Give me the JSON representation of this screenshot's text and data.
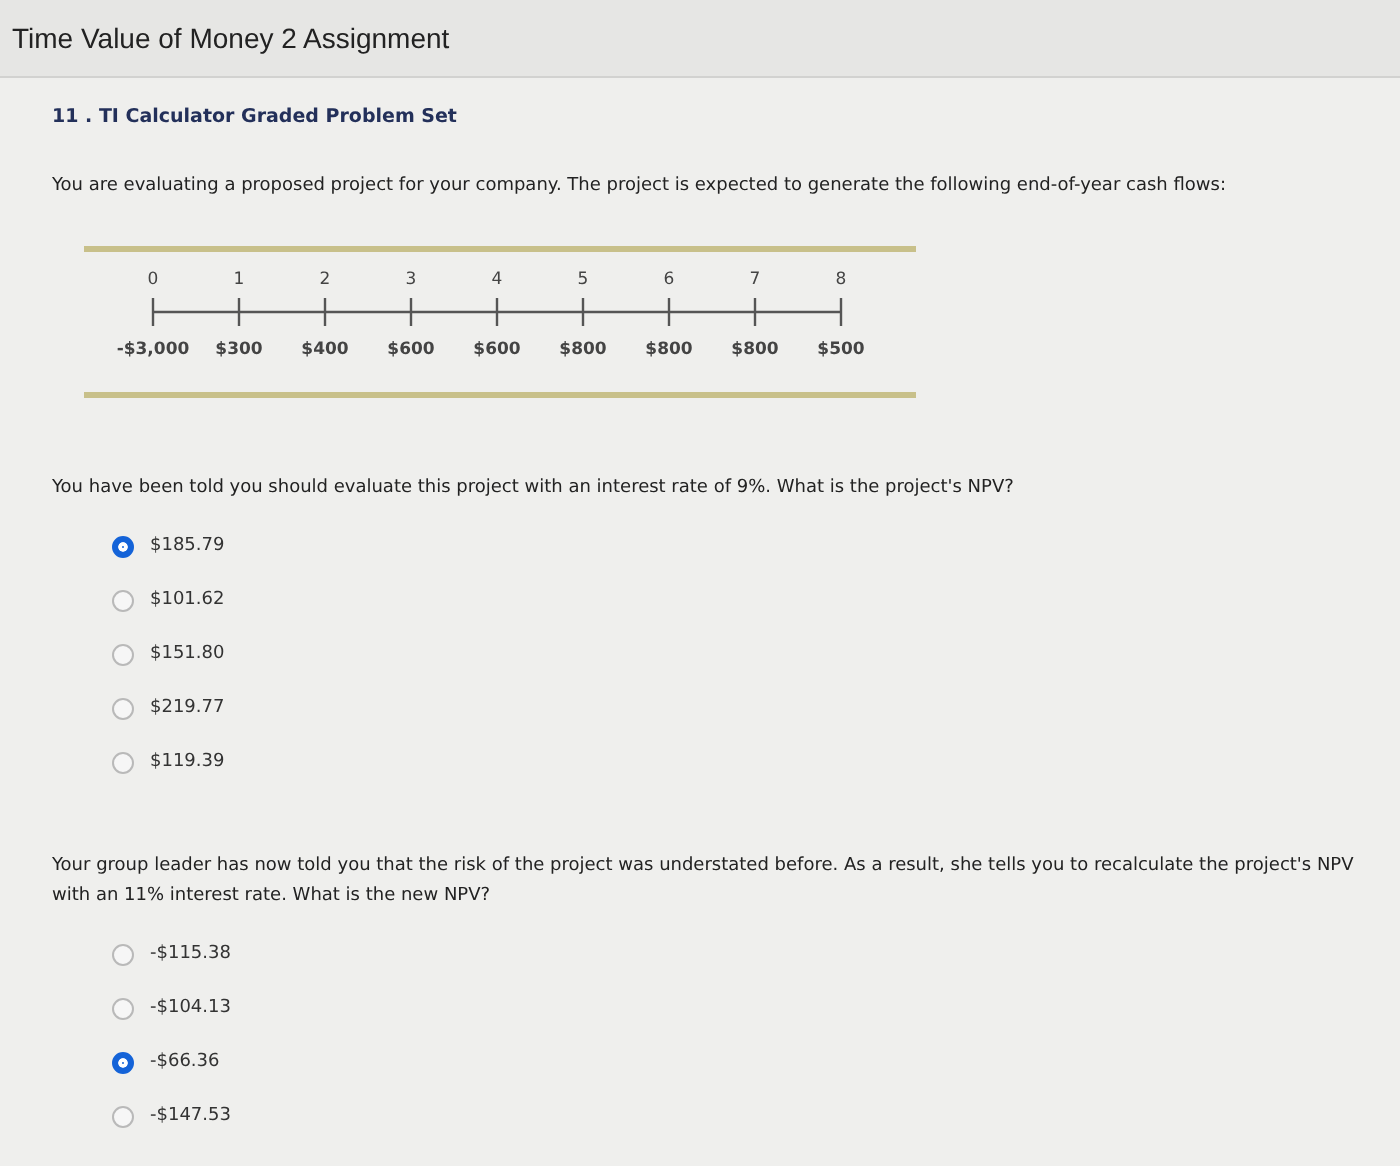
{
  "window": {
    "title": "Time Value of Money 2 Assignment"
  },
  "heading": "11 . TI Calculator Graded Problem Set",
  "intro": "You are evaluating a proposed project for your company. The project is expected to generate the following end-of-year cash flows:",
  "timeline": {
    "periods": [
      "0",
      "1",
      "2",
      "3",
      "4",
      "5",
      "6",
      "7",
      "8"
    ],
    "cash_flows": [
      "-$3,000",
      "$300",
      "$400",
      "$600",
      "$600",
      "$800",
      "$800",
      "$800",
      "$500"
    ]
  },
  "questions": [
    {
      "text": "You have been told you should evaluate this project with an interest rate of 9%. What is the project's NPV?",
      "options": [
        {
          "label": "$185.79",
          "selected": true
        },
        {
          "label": "$101.62",
          "selected": false
        },
        {
          "label": "$151.80",
          "selected": false
        },
        {
          "label": "$219.77",
          "selected": false
        },
        {
          "label": "$119.39",
          "selected": false
        }
      ]
    },
    {
      "text": "Your group leader has now told you that the risk of the project was understated before. As a result, she tells you to recalculate the project's NPV with an 11% interest rate. What is the new NPV?",
      "options": [
        {
          "label": "-$115.38",
          "selected": false
        },
        {
          "label": "-$104.13",
          "selected": false
        },
        {
          "label": "-$66.36",
          "selected": true
        },
        {
          "label": "-$147.53",
          "selected": false
        }
      ]
    }
  ]
}
